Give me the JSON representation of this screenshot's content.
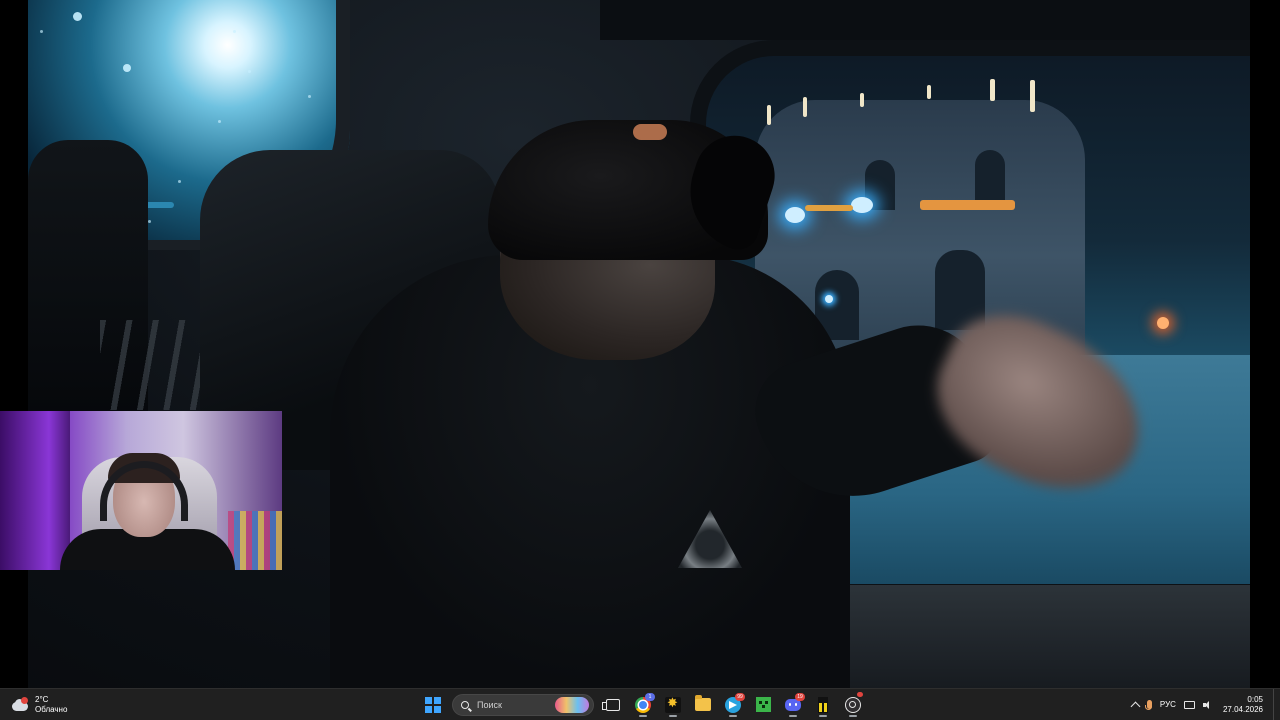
{
  "taskbar": {
    "weather": {
      "temperature": "2°C",
      "condition": "Облачно",
      "icon": "cloud-icon"
    },
    "search": {
      "placeholder": "Поиск"
    },
    "apps": [
      {
        "name": "start",
        "icon": "windows-start-icon"
      },
      {
        "name": "task-view",
        "icon": "task-view-icon"
      },
      {
        "name": "chrome",
        "icon": "chrome-icon",
        "badge": "1"
      },
      {
        "name": "star-app",
        "icon": "star-app-icon"
      },
      {
        "name": "file-explorer",
        "icon": "folder-icon"
      },
      {
        "name": "telegram",
        "icon": "telegram-icon",
        "badge": "99"
      },
      {
        "name": "minecraft",
        "icon": "minecraft-icon"
      },
      {
        "name": "discord",
        "icon": "discord-icon",
        "badge": "19"
      },
      {
        "name": "yellow-app",
        "icon": "yellow-bars-icon"
      },
      {
        "name": "obs",
        "icon": "obs-icon"
      }
    ],
    "tray": {
      "language": "РУС",
      "time": "0:05",
      "date": "27.04.2026"
    }
  },
  "colors": {
    "taskbar_bg": "#202020",
    "accent_blue": "#3fa6ff",
    "badge_red": "#e0443e"
  }
}
